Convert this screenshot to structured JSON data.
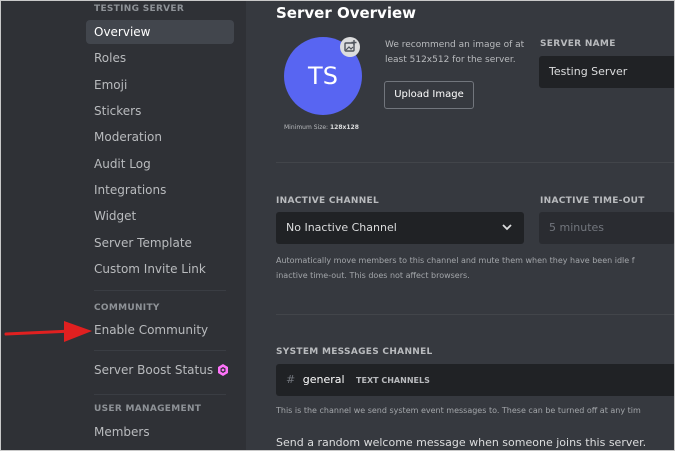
{
  "sidebar": {
    "server_category": "TESTING SERVER",
    "items": [
      {
        "label": "Overview",
        "active": true
      },
      {
        "label": "Roles"
      },
      {
        "label": "Emoji"
      },
      {
        "label": "Stickers"
      },
      {
        "label": "Moderation"
      },
      {
        "label": "Audit Log"
      },
      {
        "label": "Integrations"
      },
      {
        "label": "Widget"
      },
      {
        "label": "Server Template"
      },
      {
        "label": "Custom Invite Link"
      }
    ],
    "community_category": "COMMUNITY",
    "enable_community": "Enable Community",
    "server_boost_status": "Server Boost Status",
    "user_management_category": "USER MANAGEMENT",
    "members": "Members"
  },
  "main": {
    "title": "Server Overview",
    "avatar_initials": "TS",
    "min_size_label": "Minimum Size:",
    "min_size_value": "128x128",
    "recommend_text": "We recommend an image of at least 512x512 for the server.",
    "upload_button": "Upload Image",
    "server_name_label": "SERVER NAME",
    "server_name_value": "Testing Server",
    "inactive_channel_label": "INACTIVE CHANNEL",
    "inactive_channel_value": "No Inactive Channel",
    "inactive_timeout_label": "INACTIVE TIME-OUT",
    "inactive_timeout_value": "5 minutes",
    "inactive_help_1": "Automatically move members to this channel and mute them when they have been idle f",
    "inactive_help_2": "inactive time-out. This does not affect browsers.",
    "system_channel_label": "SYSTEM MESSAGES CHANNEL",
    "system_channel_hash": "#",
    "system_channel_name": "general",
    "system_channel_category": "TEXT CHANNELS",
    "system_help": "This is the channel we send system event messages to. These can be turned off at any tim",
    "welcome_text": "Send a random welcome message when someone joins this server."
  },
  "colors": {
    "accent": "#5865f2",
    "arrow": "#e02020",
    "boost": "#ff73fa"
  }
}
